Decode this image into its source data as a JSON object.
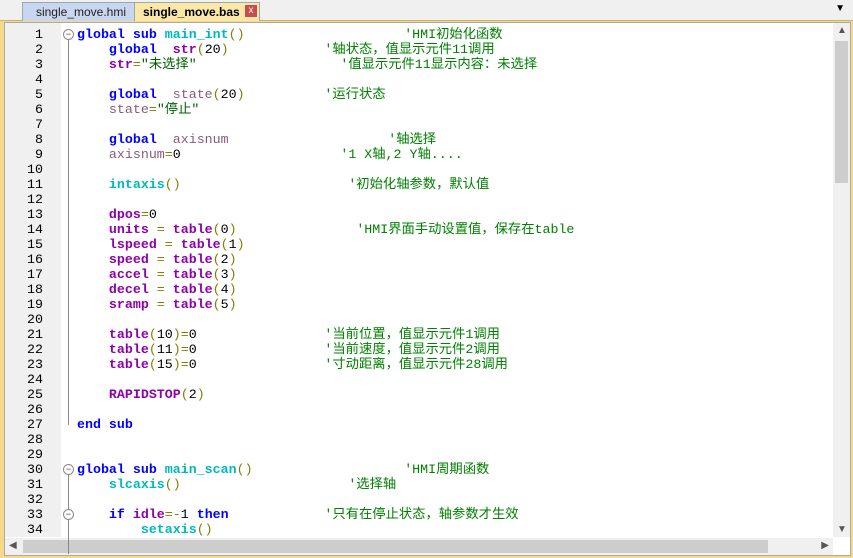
{
  "tabs": [
    {
      "label": "single_move.hmi"
    },
    {
      "label": "single_move.bas",
      "active": true
    }
  ],
  "tab_close": "x",
  "folds": [
    1,
    30,
    33
  ],
  "lines": [
    [
      [
        "global ",
        "kw"
      ],
      [
        "sub ",
        "kw"
      ],
      [
        "main_int",
        "fn"
      ],
      [
        "()",
        "p"
      ],
      [
        "                    ",
        "t"
      ],
      [
        "'HMI初始化函数",
        "c"
      ]
    ],
    [
      [
        "    global  ",
        "kw"
      ],
      [
        "str",
        "id"
      ],
      [
        "(",
        "p"
      ],
      [
        "20",
        "n"
      ],
      [
        ")",
        "p"
      ],
      [
        "            ",
        "t"
      ],
      [
        "'轴状态，值显示元件11调用",
        "c"
      ]
    ],
    [
      [
        "    str",
        "id"
      ],
      [
        "=",
        "p"
      ],
      [
        "\"未选择\"",
        "s"
      ],
      [
        "                  ",
        "t"
      ],
      [
        "'值显示元件11显示内容：未选择",
        "c"
      ]
    ],
    [],
    [
      [
        "    global  ",
        "kw"
      ],
      [
        "state",
        "var"
      ],
      [
        "(",
        "p"
      ],
      [
        "20",
        "n"
      ],
      [
        ")",
        "p"
      ],
      [
        "          ",
        "t"
      ],
      [
        "'运行状态",
        "c"
      ]
    ],
    [
      [
        "    state",
        "var"
      ],
      [
        "=",
        "p"
      ],
      [
        "\"停止\"",
        "s"
      ]
    ],
    [],
    [
      [
        "    global  ",
        "kw"
      ],
      [
        "axisnum",
        "var"
      ],
      [
        "                    ",
        "t"
      ],
      [
        "'轴选择",
        "c"
      ]
    ],
    [
      [
        "    axisnum",
        "var"
      ],
      [
        "=",
        "p"
      ],
      [
        "0",
        "n"
      ],
      [
        "                    ",
        "t"
      ],
      [
        "'1 X轴,2 Y轴....",
        "c"
      ]
    ],
    [],
    [
      [
        "    intaxis",
        "fn"
      ],
      [
        "()",
        "p"
      ],
      [
        "                     ",
        "t"
      ],
      [
        "'初始化轴参数，默认值",
        "c"
      ]
    ],
    [],
    [
      [
        "    dpos",
        "id"
      ],
      [
        "=",
        "p"
      ],
      [
        "0",
        "n"
      ]
    ],
    [
      [
        "    units ",
        "id"
      ],
      [
        "= ",
        "p"
      ],
      [
        "table",
        "id"
      ],
      [
        "(",
        "p"
      ],
      [
        "0",
        "n"
      ],
      [
        ")",
        "p"
      ],
      [
        "               ",
        "t"
      ],
      [
        "'HMI界面手动设置值，保存在table",
        "c"
      ]
    ],
    [
      [
        "    lspeed ",
        "id"
      ],
      [
        "= ",
        "p"
      ],
      [
        "table",
        "id"
      ],
      [
        "(",
        "p"
      ],
      [
        "1",
        "n"
      ],
      [
        ")",
        "p"
      ]
    ],
    [
      [
        "    speed ",
        "id"
      ],
      [
        "= ",
        "p"
      ],
      [
        "table",
        "id"
      ],
      [
        "(",
        "p"
      ],
      [
        "2",
        "n"
      ],
      [
        ")",
        "p"
      ]
    ],
    [
      [
        "    accel ",
        "id"
      ],
      [
        "= ",
        "p"
      ],
      [
        "table",
        "id"
      ],
      [
        "(",
        "p"
      ],
      [
        "3",
        "n"
      ],
      [
        ")",
        "p"
      ]
    ],
    [
      [
        "    decel ",
        "id"
      ],
      [
        "= ",
        "p"
      ],
      [
        "table",
        "id"
      ],
      [
        "(",
        "p"
      ],
      [
        "4",
        "n"
      ],
      [
        ")",
        "p"
      ]
    ],
    [
      [
        "    sramp ",
        "id"
      ],
      [
        "= ",
        "p"
      ],
      [
        "table",
        "id"
      ],
      [
        "(",
        "p"
      ],
      [
        "5",
        "n"
      ],
      [
        ")",
        "p"
      ]
    ],
    [],
    [
      [
        "    table",
        "id"
      ],
      [
        "(",
        "p"
      ],
      [
        "10",
        "n"
      ],
      [
        ")=",
        "p"
      ],
      [
        "0",
        "n"
      ],
      [
        "                ",
        "t"
      ],
      [
        "'当前位置，值显示元件1调用",
        "c"
      ]
    ],
    [
      [
        "    table",
        "id"
      ],
      [
        "(",
        "p"
      ],
      [
        "11",
        "n"
      ],
      [
        ")=",
        "p"
      ],
      [
        "0",
        "n"
      ],
      [
        "                ",
        "t"
      ],
      [
        "'当前速度，值显示元件2调用",
        "c"
      ]
    ],
    [
      [
        "    table",
        "id"
      ],
      [
        "(",
        "p"
      ],
      [
        "15",
        "n"
      ],
      [
        ")=",
        "p"
      ],
      [
        "0",
        "n"
      ],
      [
        "                ",
        "t"
      ],
      [
        "'寸动距离，值显示元件28调用",
        "c"
      ]
    ],
    [],
    [
      [
        "    RAPIDSTOP",
        "id"
      ],
      [
        "(",
        "p"
      ],
      [
        "2",
        "n"
      ],
      [
        ")",
        "p"
      ]
    ],
    [],
    [
      [
        "end ",
        "kw"
      ],
      [
        "sub",
        "kw"
      ]
    ],
    [],
    [],
    [
      [
        "global ",
        "kw"
      ],
      [
        "sub ",
        "kw"
      ],
      [
        "main_scan",
        "fn"
      ],
      [
        "()",
        "p"
      ],
      [
        "                   ",
        "t"
      ],
      [
        "'HMI周期函数",
        "c"
      ]
    ],
    [
      [
        "    slcaxis",
        "fn"
      ],
      [
        "()",
        "p"
      ],
      [
        "                     ",
        "t"
      ],
      [
        "'选择轴",
        "c"
      ]
    ],
    [],
    [
      [
        "    if ",
        "kw"
      ],
      [
        "idle",
        "id"
      ],
      [
        "=-",
        "p"
      ],
      [
        "1 ",
        "n"
      ],
      [
        "then",
        "kw"
      ],
      [
        "            ",
        "t"
      ],
      [
        "'只有在停止状态，轴参数才生效",
        "c"
      ]
    ],
    [
      [
        "        setaxis",
        "fn"
      ],
      [
        "()",
        "p"
      ]
    ]
  ]
}
